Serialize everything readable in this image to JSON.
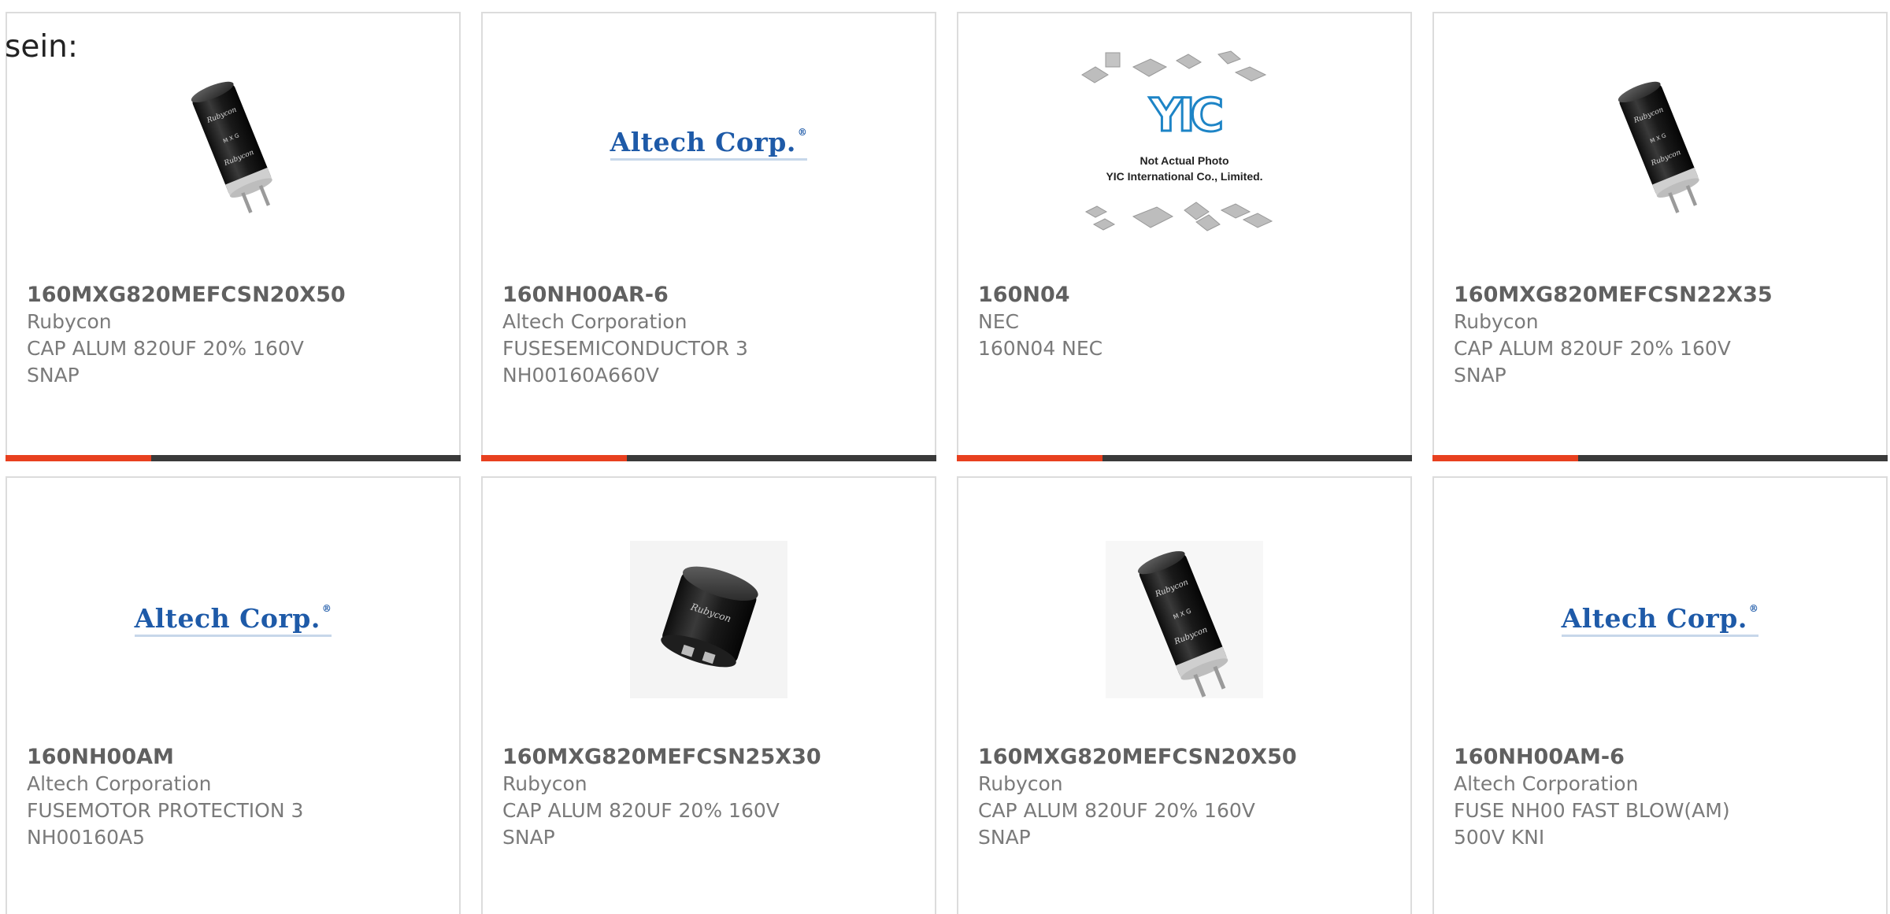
{
  "lead_text": "sein:",
  "accent_color": "#e8401f",
  "track_color": "#3a3a3a",
  "products": [
    {
      "part": "160MXG820MEFCSN20X50",
      "manufacturer": "Rubycon",
      "description": "CAP ALUM 820UF 20% 160V SNAP",
      "image": "capacitor-image",
      "progress": 0.32
    },
    {
      "part": "160NH00AR-6",
      "manufacturer": "Altech Corporation",
      "description": "FUSESEMICONDUCTOR 3 NH00160A660V",
      "image": "altech-logo",
      "progress": 0.32
    },
    {
      "part": "160N04",
      "manufacturer": "NEC",
      "description": "160N04 NEC",
      "image": "yic-placeholder",
      "progress": 0.32
    },
    {
      "part": "160MXG820MEFCSN22X35",
      "manufacturer": "Rubycon",
      "description": "CAP ALUM 820UF 20% 160V SNAP",
      "image": "capacitor-image",
      "progress": 0.32
    },
    {
      "part": "160NH00AM",
      "manufacturer": "Altech Corporation",
      "description": "FUSEMOTOR PROTECTION 3 NH00160A5",
      "image": "altech-logo",
      "progress": 0
    },
    {
      "part": "160MXG820MEFCSN25X30",
      "manufacturer": "Rubycon",
      "description": "CAP ALUM 820UF 20% 160V SNAP",
      "image": "snap-capacitor-image",
      "progress": 0
    },
    {
      "part": "160MXG820MEFCSN20X50",
      "manufacturer": "Rubycon",
      "description": "CAP ALUM 820UF 20% 160V SNAP",
      "image": "capacitor-image",
      "progress": 0
    },
    {
      "part": "160NH00AM-6",
      "manufacturer": "Altech Corporation",
      "description": "FUSE NH00 FAST BLOW(AM) 500V KNI",
      "image": "altech-logo",
      "progress": 0
    }
  ],
  "altech_logo_text": "Altech Corp.",
  "altech_logo_mark": "®",
  "yic_mark": "YIC",
  "yic_line1": "Not Actual Photo",
  "yic_line2": "YIC International Co., Limited."
}
